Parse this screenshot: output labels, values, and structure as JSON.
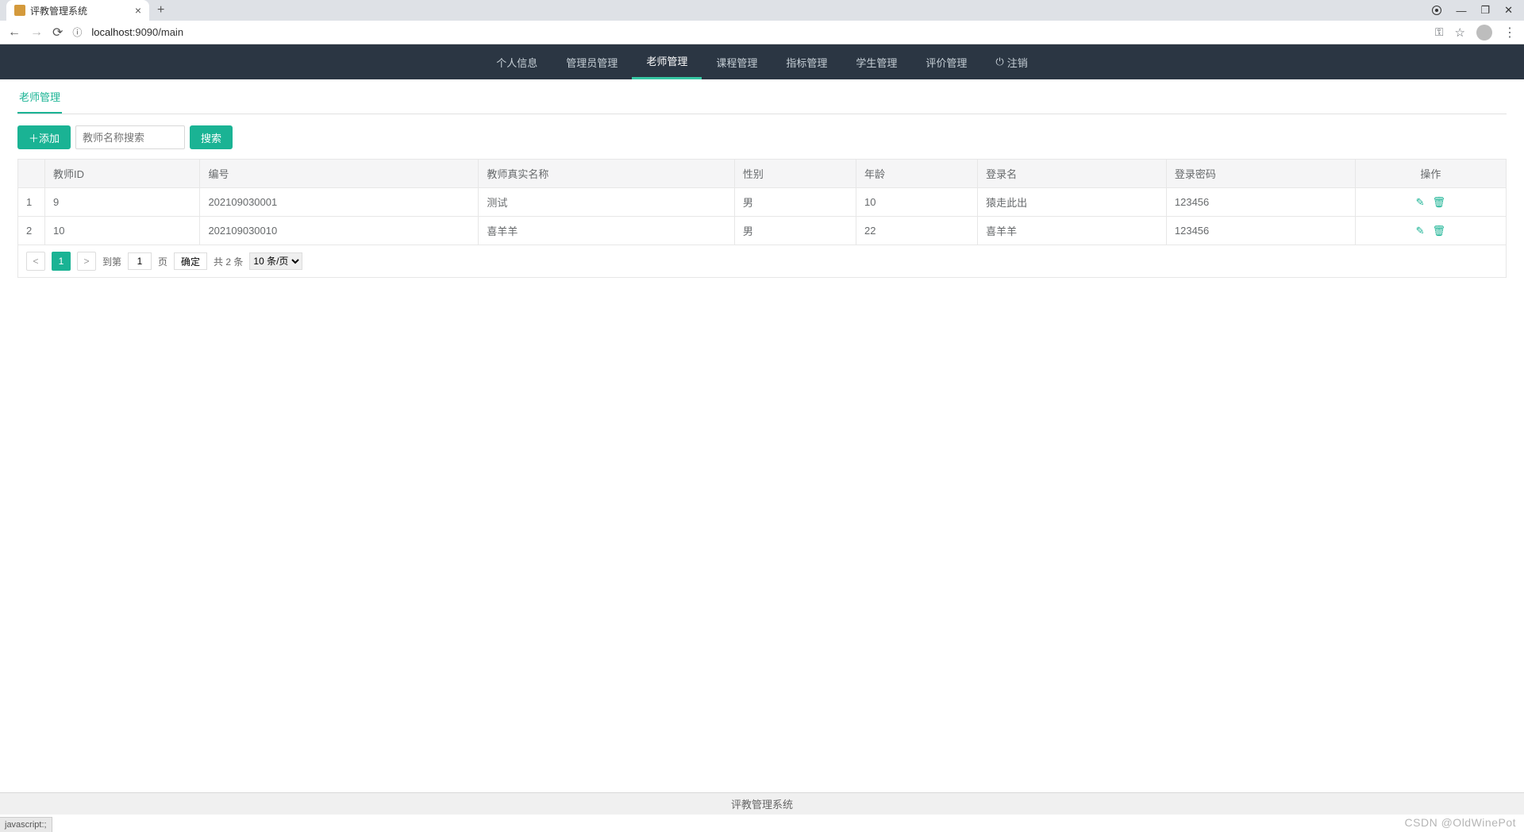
{
  "browser": {
    "tab_title": "评教管理系统",
    "url_host": "localhost",
    "url_rest": ":9090/main",
    "status_text": "javascript:;"
  },
  "nav": {
    "items": [
      "个人信息",
      "管理员管理",
      "老师管理",
      "课程管理",
      "指标管理",
      "学生管理",
      "评价管理"
    ],
    "logout": "注销",
    "active_index": 2
  },
  "sub_tab": "老师管理",
  "toolbar": {
    "add_label": "添加",
    "search_placeholder": "教师名称搜索",
    "search_btn": "搜索"
  },
  "table": {
    "headers": [
      "",
      "教师ID",
      "编号",
      "教师真实名称",
      "性别",
      "年龄",
      "登录名",
      "登录密码",
      "操作"
    ],
    "rows": [
      {
        "idx": "1",
        "teacher_id": "9",
        "code": "202109030001",
        "name": "测试",
        "gender": "男",
        "age": "10",
        "login": "猿走此出",
        "password": "123456"
      },
      {
        "idx": "2",
        "teacher_id": "10",
        "code": "202109030010",
        "name": "喜羊羊",
        "gender": "男",
        "age": "22",
        "login": "喜羊羊",
        "password": "123456"
      }
    ]
  },
  "pager": {
    "current": "1",
    "goto_label": "到第",
    "goto_value": "1",
    "page_label": "页",
    "confirm": "确定",
    "total": "共 2 条",
    "per_page": "10 条/页"
  },
  "footer": "评教管理系统",
  "watermark": "CSDN @OldWinePot"
}
